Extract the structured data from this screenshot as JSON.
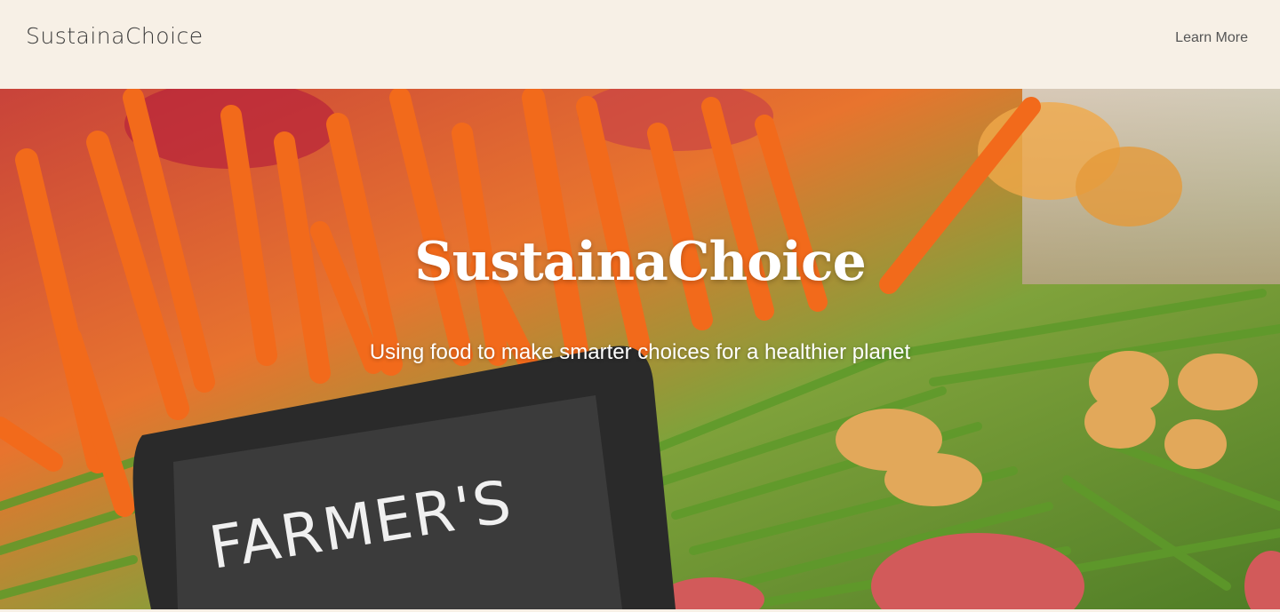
{
  "header": {
    "brand": "SustainaChoice",
    "nav_link": "Learn More"
  },
  "hero": {
    "title": "SustainaChoice",
    "subtitle": "Using food to make smarter choices for a healthier planet",
    "sign_text": "FARMER'S"
  },
  "colors": {
    "header_bg": "#f7f0e6",
    "carrot": "#f26a1b",
    "beans": "#5c9a2e",
    "potato": "#e8b15a",
    "chalkboard": "#3b3b3b"
  }
}
